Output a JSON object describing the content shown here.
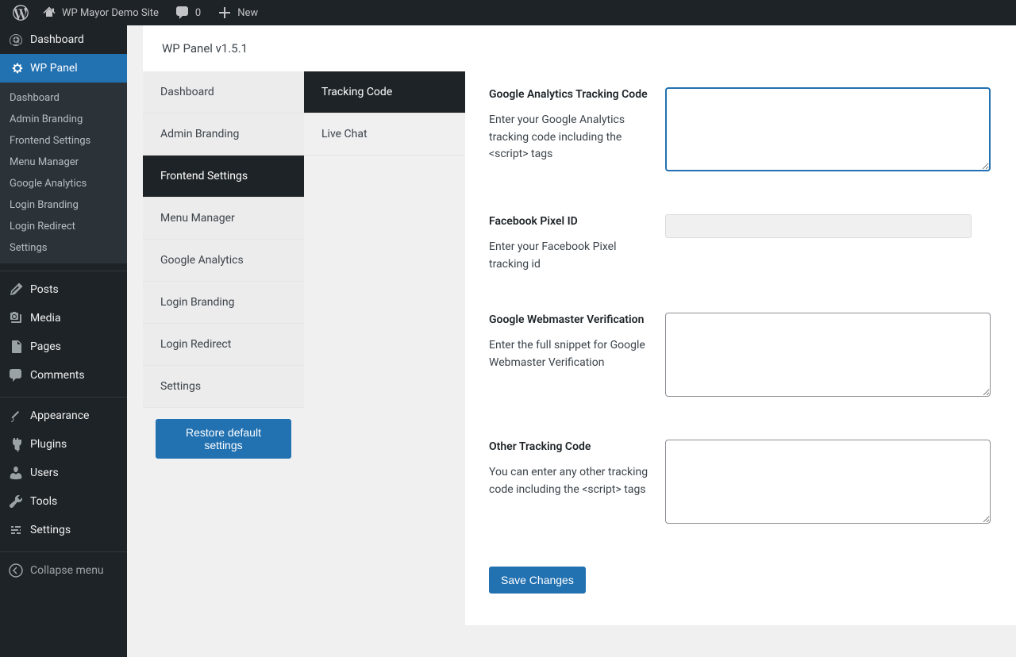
{
  "topbar": {
    "site_name": "WP Mayor Demo Site",
    "comments_count": "0",
    "new_label": "New"
  },
  "adminmenu": {
    "dashboard": "Dashboard",
    "wppanel": "WP Panel",
    "submenu": [
      "Dashboard",
      "Admin Branding",
      "Frontend Settings",
      "Menu Manager",
      "Google Analytics",
      "Login Branding",
      "Login Redirect",
      "Settings"
    ],
    "posts": "Posts",
    "media": "Media",
    "pages": "Pages",
    "comments": "Comments",
    "appearance": "Appearance",
    "plugins": "Plugins",
    "users": "Users",
    "tools": "Tools",
    "settings": "Settings",
    "collapse": "Collapse menu"
  },
  "page": {
    "title": "WP Panel v1.5.1"
  },
  "col1": [
    "Dashboard",
    "Admin Branding",
    "Frontend Settings",
    "Menu Manager",
    "Google Analytics",
    "Login Branding",
    "Login Redirect",
    "Settings"
  ],
  "col1_restore": "Restore default settings",
  "col2": [
    "Tracking Code",
    "Live Chat"
  ],
  "form": {
    "ga_label": "Google Analytics Tracking Code",
    "ga_desc": "Enter your Google Analytics tracking code including the <script> tags",
    "fb_label": "Facebook Pixel ID",
    "fb_desc": "Enter your Facebook Pixel tracking id",
    "gwv_label": "Google Webmaster Verification",
    "gwv_desc": "Enter the full snippet for Google Webmaster Verification",
    "other_label": "Other Tracking Code",
    "other_desc": "You can enter any other tracking code including the <script> tags",
    "save": "Save Changes"
  }
}
